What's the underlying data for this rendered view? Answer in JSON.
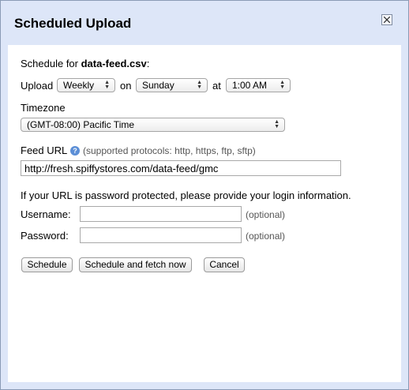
{
  "dialog": {
    "title": "Scheduled Upload"
  },
  "schedule": {
    "label_prefix": "Schedule for ",
    "filename": "data-feed.csv",
    "label_suffix": ":"
  },
  "upload_row": {
    "upload_label": "Upload",
    "frequency": "Weekly",
    "on_label": "on",
    "day": "Sunday",
    "at_label": "at",
    "time": "1:00 AM"
  },
  "timezone": {
    "label": "Timezone",
    "value": "(GMT-08:00) Pacific Time"
  },
  "feed_url": {
    "label": "Feed URL",
    "help_icon_text": "?",
    "protocols_note": "(supported protocols: http, https, ftp, sftp)",
    "value": "http://fresh.spiffystores.com/data-feed/gmc"
  },
  "login": {
    "instructions": "If your URL is password protected, please provide your login information.",
    "username_label": "Username:",
    "username_value": "",
    "username_optional": "(optional)",
    "password_label": "Password:",
    "password_value": "",
    "password_optional": "(optional)"
  },
  "buttons": {
    "schedule": "Schedule",
    "schedule_fetch": "Schedule and fetch now",
    "cancel": "Cancel"
  },
  "icons": {
    "close": "close-icon",
    "help": "help-icon",
    "select_arrows": "updown-arrows-icon"
  },
  "colors": {
    "titlebar_bg": "#dde6f8",
    "border": "#8a9bb5",
    "help_icon": "#5b8ed6"
  }
}
